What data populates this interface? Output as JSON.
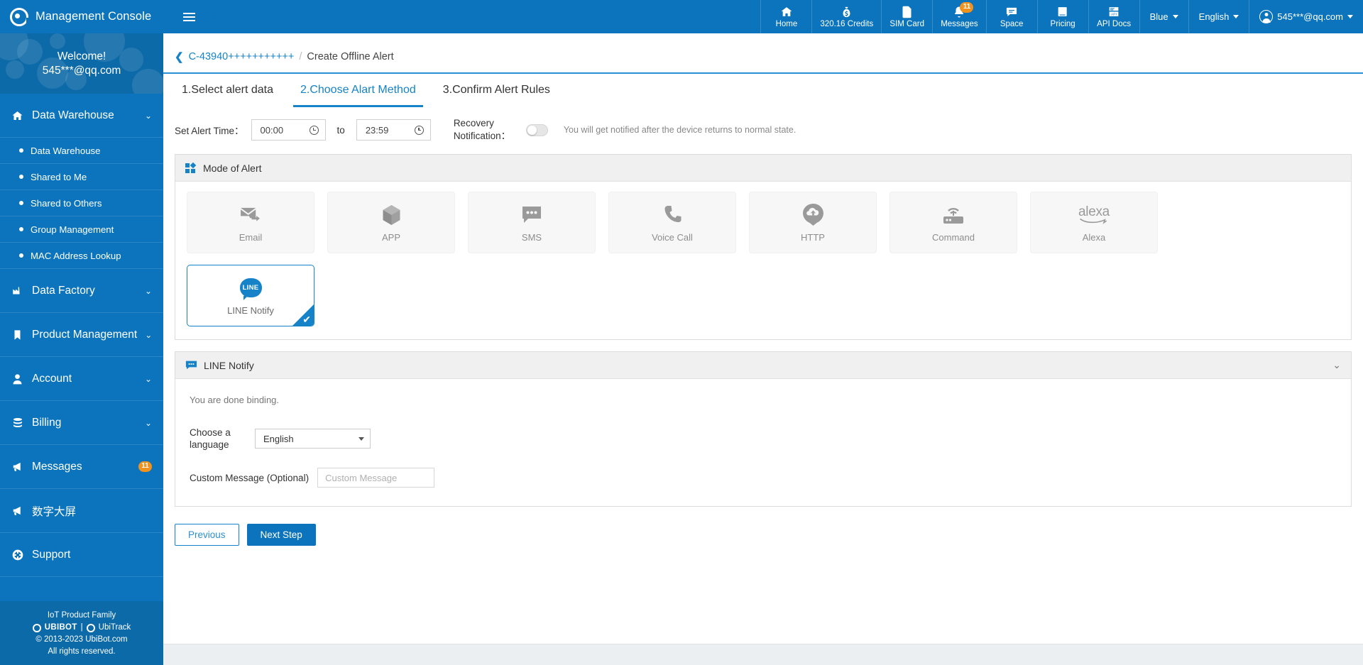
{
  "topbar": {
    "brand": "Management Console",
    "menu_icon": "hamburger-icon",
    "nav": [
      {
        "label": "Home",
        "icon": "home-icon"
      },
      {
        "label": "320.16 Credits",
        "icon": "money-bag-icon"
      },
      {
        "label": "SIM Card",
        "icon": "sim-card-icon"
      },
      {
        "label": "Messages",
        "icon": "message-bubble-icon",
        "badge": "11"
      },
      {
        "label": "Space",
        "icon": "chat-icon"
      },
      {
        "label": "Pricing",
        "icon": "book-icon"
      },
      {
        "label": "API Docs",
        "icon": "api-doc-icon"
      }
    ],
    "theme": {
      "label": "Blue"
    },
    "language": {
      "label": "English"
    },
    "account": {
      "label": "545***@qq.com",
      "icon": "user-avatar-icon"
    }
  },
  "sidebar": {
    "welcome_line1": "Welcome!",
    "welcome_line2": "545***@qq.com",
    "groups": [
      {
        "label": "Data Warehouse",
        "icon": "home-icon",
        "chevron": "chevron-down-icon",
        "children": [
          {
            "label": "Data Warehouse"
          },
          {
            "label": "Shared to Me"
          },
          {
            "label": "Shared to Others"
          },
          {
            "label": "Group Management"
          },
          {
            "label": "MAC Address Lookup"
          }
        ]
      },
      {
        "label": "Data Factory",
        "icon": "factory-icon",
        "chevron": "chevron-down-icon",
        "children": []
      },
      {
        "label": "Product Management",
        "icon": "bookmark-icon",
        "chevron": "chevron-down-icon",
        "children": []
      },
      {
        "label": "Account",
        "icon": "user-icon",
        "chevron": "chevron-down-icon",
        "children": []
      },
      {
        "label": "Billing",
        "icon": "database-icon",
        "chevron": "chevron-down-icon",
        "children": []
      },
      {
        "label": "Messages",
        "icon": "megaphone-icon",
        "badge": "11",
        "children": []
      },
      {
        "label": "数字大屏",
        "icon": "megaphone-icon",
        "children": []
      },
      {
        "label": "Support",
        "icon": "lifebuoy-icon",
        "children": []
      }
    ],
    "footer": {
      "family": "IoT Product Family",
      "brand1": "UBIBOT",
      "divider": "|",
      "brand2": "UbiTrack",
      "copyright": "© 2013-2023 UbiBot.com",
      "rights": "All rights reserved."
    }
  },
  "breadcrumb": {
    "back_icon": "chevron-left-icon",
    "parent": "C-43940+++++++++++",
    "separator": "/",
    "current": "Create Offline Alert"
  },
  "tabs": [
    {
      "label": "1.Select alert data",
      "active": false
    },
    {
      "label": "2.Choose Alart Method",
      "active": true
    },
    {
      "label": "3.Confirm Alert Rules",
      "active": false
    }
  ],
  "alert_time": {
    "label": "Set Alert Time：",
    "from": "00:00",
    "to_label": "to",
    "until": "23:59",
    "clock_icon": "clock-icon",
    "recovery_label": "Recovery Notification：",
    "recovery_enabled": false,
    "recovery_hint": "You will get notified after the device returns to normal state."
  },
  "mode_panel": {
    "title": "Mode of Alert",
    "icon": "grid-squares-icon",
    "cards": [
      {
        "label": "Email",
        "icon": "email-icon",
        "selected": false
      },
      {
        "label": "APP",
        "icon": "cube-icon",
        "selected": false
      },
      {
        "label": "SMS",
        "icon": "sms-bubble-icon",
        "selected": false
      },
      {
        "label": "Voice Call",
        "icon": "phone-icon",
        "selected": false
      },
      {
        "label": "HTTP",
        "icon": "cloud-upload-icon",
        "selected": false
      },
      {
        "label": "Command",
        "icon": "router-signal-icon",
        "selected": false
      },
      {
        "label": "Alexa",
        "icon": "alexa-logo-icon",
        "selected": false
      },
      {
        "label": "LINE Notify",
        "icon": "line-logo-icon",
        "selected": true
      }
    ]
  },
  "notify_panel": {
    "title": "LINE Notify",
    "icon": "sms-bubble-icon",
    "chevron": "chevron-down-icon",
    "bound_text": "You are done binding.",
    "language_label": "Choose a language",
    "language_value": "English",
    "custom_message_label": "Custom Message (Optional)",
    "custom_message_value": "",
    "custom_message_placeholder": "Custom Message"
  },
  "footer_buttons": {
    "previous": "Previous",
    "next": "Next Step"
  },
  "colors": {
    "brand_blue": "#0b74bc",
    "link_blue": "#1683c8",
    "badge_orange": "#f0921e",
    "panel_gray": "#f0f0f0"
  }
}
